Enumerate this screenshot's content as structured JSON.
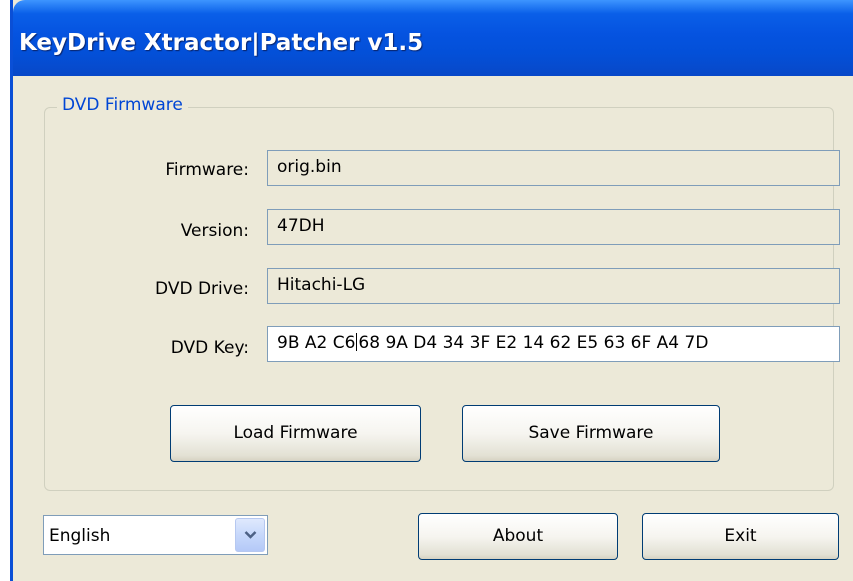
{
  "window": {
    "title": "KeyDrive Xtractor|Patcher v1.5"
  },
  "group": {
    "title": "DVD Firmware",
    "fields": {
      "firmware": {
        "label": "Firmware:",
        "value": "orig.bin"
      },
      "version": {
        "label": "Version:",
        "value": "47DH"
      },
      "drive": {
        "label": "DVD Drive:",
        "value": "Hitachi-LG"
      },
      "key": {
        "label": "DVD Key:",
        "value_before_caret": "9B A2 C6",
        "value_after_caret": "68 9A D4 34 3F E2 14 62 E5 63 6F A4 7D"
      }
    },
    "buttons": {
      "load": "Load Firmware",
      "save": "Save Firmware"
    }
  },
  "footer": {
    "language": {
      "selected": "English"
    },
    "about": "About",
    "exit": "Exit"
  },
  "colors": {
    "titlebar": "#0553e0",
    "window_bg": "#ece9d8",
    "group_title": "#0046d5"
  }
}
